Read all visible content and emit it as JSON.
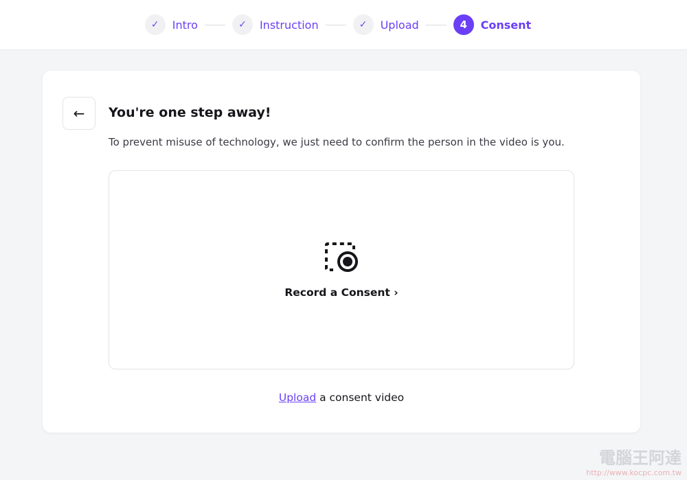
{
  "stepper": {
    "steps": [
      {
        "label": "Intro",
        "state": "done",
        "icon": "check-icon"
      },
      {
        "label": "Instruction",
        "state": "done",
        "icon": "check-icon"
      },
      {
        "label": "Upload",
        "state": "done",
        "icon": "check-icon"
      },
      {
        "label": "Consent",
        "state": "active",
        "number": "4"
      }
    ]
  },
  "card": {
    "back_icon": "arrow-left-icon",
    "title": "You're one step away!",
    "subtitle": "To prevent misuse of technology, we just need to confirm the person in the video is you.",
    "record": {
      "icon": "record-screen-icon",
      "label": "Record a Consent",
      "chevron": "›"
    },
    "upload_link": "Upload",
    "upload_rest": " a consent video"
  },
  "watermark": {
    "text": "電腦王阿達",
    "url": "http://www.kocpc.com.tw"
  },
  "colors": {
    "accent": "#6a3ff5"
  }
}
